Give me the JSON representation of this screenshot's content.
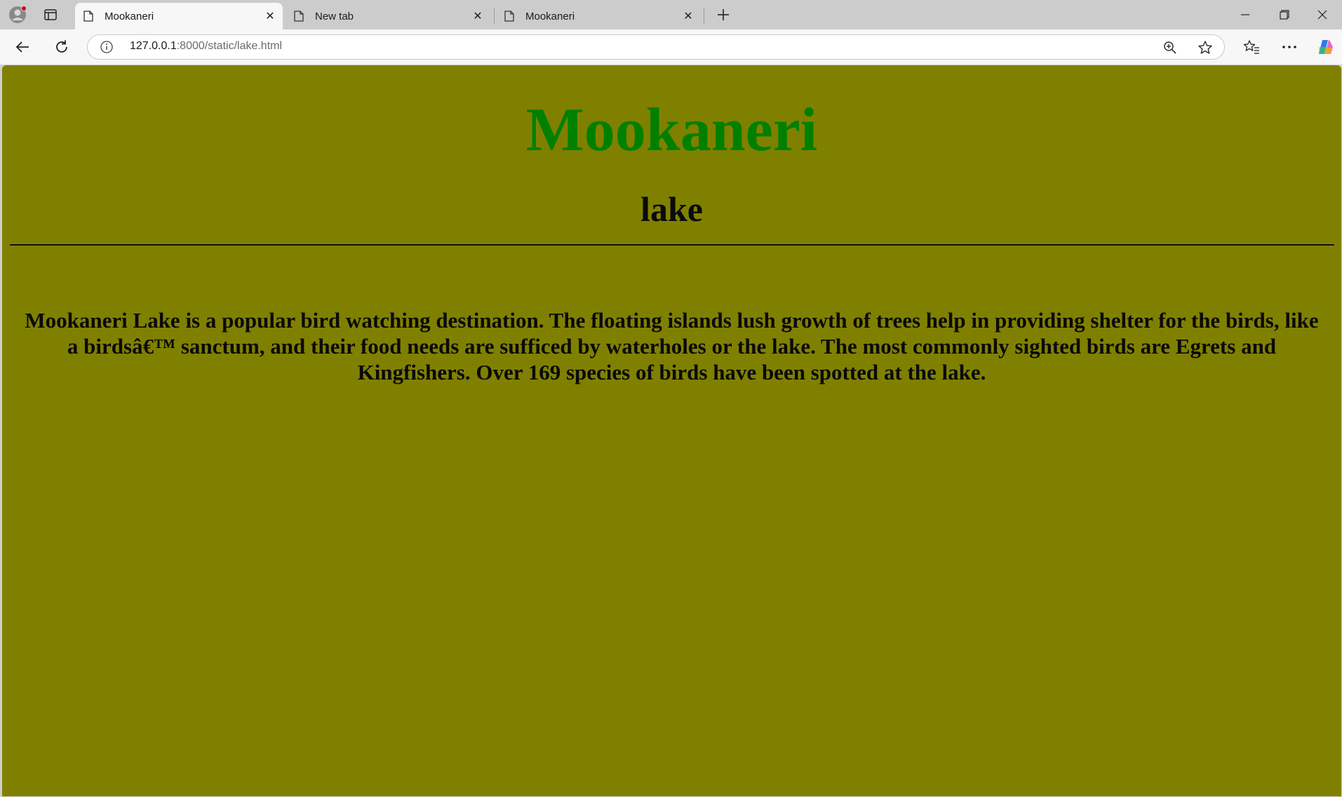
{
  "browser": {
    "tabs": [
      {
        "label": "Mookaneri",
        "active": true
      },
      {
        "label": "New tab",
        "active": false
      },
      {
        "label": "Mookaneri",
        "active": false
      }
    ],
    "url_host": "127.0.0.1",
    "url_rest": ":8000/static/lake.html",
    "icons": [
      "profile-icon",
      "tab-actions-icon",
      "document-icon",
      "close-icon",
      "new-tab-icon",
      "minimize-icon",
      "restore-icon",
      "window-close-icon",
      "back-icon",
      "reload-icon",
      "info-icon",
      "zoom-icon",
      "favorite-star-icon",
      "favorites-icon",
      "more-icon",
      "copilot-icon"
    ]
  },
  "page": {
    "title": "Mookaneri",
    "subtitle": "lake",
    "paragraph": "Mookaneri Lake is a popular bird watching destination. The floating islands lush growth of trees help in providing shelter for the birds, like a birdsâ€™ sanctum, and their food needs are sufficed by waterholes or the lake. The most commonly sighted birds are Egrets and Kingfishers. Over 169 species of birds have been spotted at the lake.",
    "colors": {
      "background": "#808000",
      "title": "#008000",
      "text": "#000000"
    }
  }
}
